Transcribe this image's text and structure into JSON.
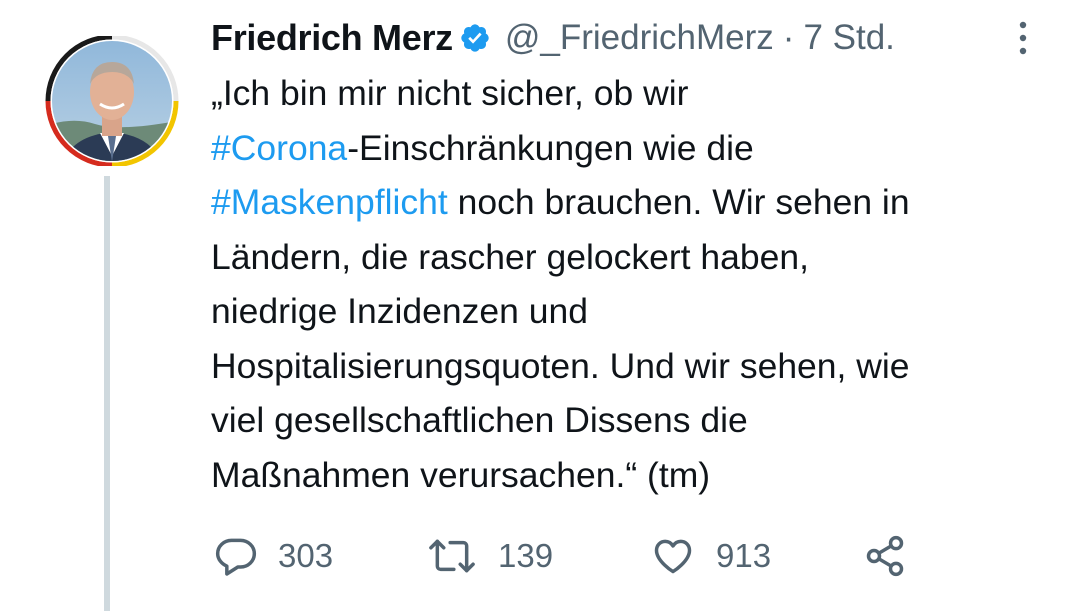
{
  "tweet": {
    "author_name": "Friedrich Merz",
    "handle": "@_FriedrichMerz",
    "separator": "·",
    "time": "7 Std.",
    "text_lines": [
      [
        {
          "t": "„Ich bin mir nicht sicher, ob wir",
          "h": false
        }
      ],
      [
        {
          "t": "#Corona",
          "h": true
        },
        {
          "t": "-Einschränkungen wie die",
          "h": false
        }
      ],
      [
        {
          "t": "#Maskenpflicht",
          "h": true
        },
        {
          "t": " noch brauchen. Wir sehen in",
          "h": false
        }
      ],
      [
        {
          "t": "Ländern, die rascher gelockert haben,",
          "h": false
        }
      ],
      [
        {
          "t": "niedrige Inzidenzen und",
          "h": false
        }
      ],
      [
        {
          "t": "Hospitalisierungsquoten. Und wir sehen, wie",
          "h": false
        }
      ],
      [
        {
          "t": "viel gesellschaftlichen Dissens die",
          "h": false
        }
      ],
      [
        {
          "t": "Maßnahmen verursachen.“ (tm)",
          "h": false
        }
      ]
    ],
    "actions": {
      "reply_count": "303",
      "retweet_count": "139",
      "like_count": "913"
    }
  },
  "icons": {
    "verified": "verified-badge-icon",
    "more": "more-options-icon",
    "reply": "reply-icon",
    "retweet": "retweet-icon",
    "like": "heart-icon",
    "share": "share-icon"
  },
  "colors": {
    "text": "#0f1419",
    "secondary": "#536471",
    "hashtag": "#1d9bf0",
    "verified": "#1d9bf0",
    "thread_line": "#cfd9de"
  }
}
